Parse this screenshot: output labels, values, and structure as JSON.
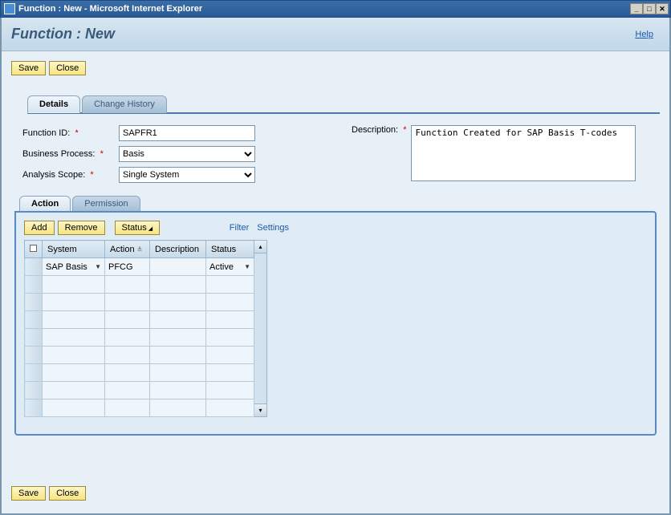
{
  "window": {
    "title": "Function : New - Microsoft Internet Explorer"
  },
  "header": {
    "title": "Function : New",
    "help": "Help"
  },
  "buttons": {
    "save": "Save",
    "close": "Close",
    "add": "Add",
    "remove": "Remove",
    "status": "Status"
  },
  "tabs": {
    "details": "Details",
    "changeHistory": "Change History"
  },
  "form": {
    "functionId": {
      "label": "Function ID:",
      "value": "SAPFR1"
    },
    "businessProcess": {
      "label": "Business Process:",
      "value": "Basis"
    },
    "analysisScope": {
      "label": "Analysis Scope:",
      "value": "Single System"
    },
    "description": {
      "label": "Description:",
      "value": "Function Created for SAP Basis T-codes"
    }
  },
  "subtabs": {
    "action": "Action",
    "permission": "Permission"
  },
  "toolbar": {
    "filter": "Filter",
    "settings": "Settings"
  },
  "grid": {
    "headers": {
      "system": "System",
      "action": "Action",
      "description": "Description",
      "status": "Status"
    },
    "rows": [
      {
        "system": "SAP Basis",
        "action": "PFCG",
        "description": "",
        "status": "Active"
      }
    ]
  },
  "chart_data": {
    "type": "table",
    "columns": [
      "System",
      "Action",
      "Description",
      "Status"
    ],
    "rows": [
      [
        "SAP Basis",
        "PFCG",
        "",
        "Active"
      ]
    ]
  }
}
